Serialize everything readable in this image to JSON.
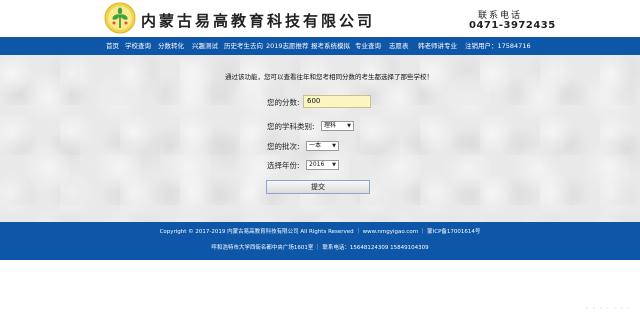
{
  "header": {
    "company_name": "内蒙古易高教育科技有限公司",
    "contact_label": "联系电话",
    "contact_phone": "0471-3972435"
  },
  "nav": {
    "items": [
      "首页",
      "学校查询",
      "分数转化",
      "兴趣测试",
      "历史考生去向",
      "2019志愿推荐",
      "报考系统模拟",
      "专业查询",
      "志愿表",
      "韩老师讲专业",
      "注销用户：17584716"
    ]
  },
  "main": {
    "intro": "通过该功能，您可以查看往年和您考相同分数的考生都选择了那些学校！",
    "score_label": "您的分数:",
    "score_value": "600",
    "subject_label": "您的学科类别:",
    "subject_value": "理科",
    "batch_label": "您的批次:",
    "batch_value": "一本",
    "year_label": "选择年份:",
    "year_value": "2016",
    "submit_label": "提交"
  },
  "footer": {
    "line1": "Copyright © 2017-2019 内蒙古易高教育科技有限公司 All Rights Reserved ｜ www.nmgyigao.com ｜ 蒙ICP备17001614号",
    "line2": "呼和浩特市大学西街名都中央广场1601室 ｜ 联系电话：15648124309 15849104309"
  }
}
